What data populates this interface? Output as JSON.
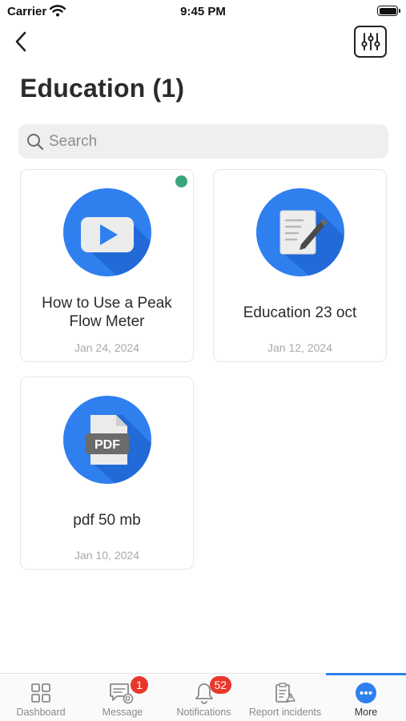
{
  "status_bar": {
    "carrier": "Carrier",
    "time": "9:45 PM"
  },
  "header": {
    "title": "Education (1)"
  },
  "search": {
    "placeholder": "Search"
  },
  "items": [
    {
      "title": "How to Use a Peak Flow Meter",
      "date": "Jan 24, 2024",
      "type": "video-icon",
      "new": true
    },
    {
      "title": "Education 23 oct",
      "date": "Jan 12, 2024",
      "type": "document-pen-icon",
      "new": false
    },
    {
      "title": "pdf 50 mb",
      "date": "Jan 10, 2024",
      "type": "pdf-file-icon",
      "new": false
    }
  ],
  "tab_bar": {
    "tabs": [
      {
        "label": "Dashboard",
        "icon": "grid-icon"
      },
      {
        "label": "Message",
        "icon": "message-icon",
        "badge": "1"
      },
      {
        "label": "Notifications",
        "icon": "bell-icon",
        "badge": "52"
      },
      {
        "label": "Report incidents",
        "icon": "report-icon"
      },
      {
        "label": "More",
        "icon": "more-icon",
        "active": true
      }
    ]
  },
  "colors": {
    "accent": "#2f7fef",
    "badge": "#e8382b",
    "new_dot": "#3aa57a"
  }
}
